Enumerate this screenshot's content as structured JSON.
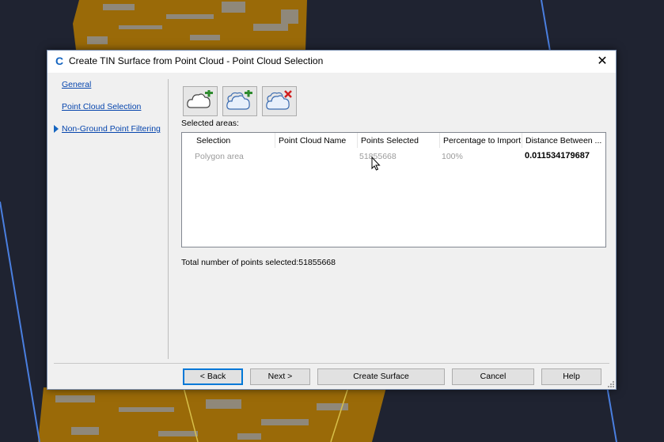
{
  "window": {
    "title": "Create TIN Surface from Point Cloud - Point Cloud Selection",
    "app_icon": "C",
    "close_glyph": "✕"
  },
  "nav": {
    "items": [
      {
        "label": "General",
        "active": false
      },
      {
        "label": "Point Cloud Selection",
        "active": true
      },
      {
        "label": "Non-Ground Point Filtering",
        "active": false
      }
    ]
  },
  "toolbar": {
    "buttons": [
      {
        "icon": "cloud-add-icon"
      },
      {
        "icon": "cloud-add-multiple-icon"
      },
      {
        "icon": "cloud-remove-icon"
      }
    ]
  },
  "selected_areas": {
    "label": "Selected areas:",
    "columns": [
      "Selection",
      "Point Cloud Name",
      "Points Selected",
      "Percentage to Import",
      "Distance Between ..."
    ],
    "rows": [
      {
        "selection": "Polygon area",
        "point_cloud_name": "",
        "points_selected": "51855668",
        "percentage": "100%",
        "distance": "0.011534179687"
      }
    ]
  },
  "total": {
    "text": "Total number of points selected:51855668"
  },
  "buttons": {
    "back": "< Back",
    "next": "Next >",
    "create": "Create Surface",
    "cancel": "Cancel",
    "help": "Help"
  },
  "colors": {
    "accent": "#0078d7",
    "link": "#0645ad",
    "terrain": "#9a6a08",
    "background": "#1f2331"
  }
}
